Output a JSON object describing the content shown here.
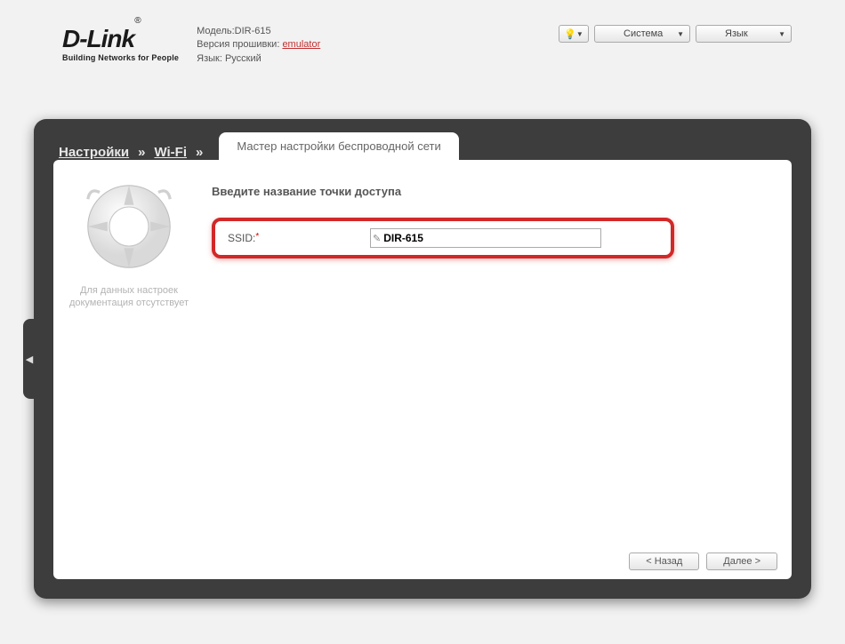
{
  "header": {
    "logo_main": "D-Link",
    "logo_sub": "Building Networks for People",
    "model_label": "Модель:",
    "model_value": "DIR-615",
    "fw_label": "Версия прошивки:",
    "fw_value": "emulator",
    "lang_label": "Язык:",
    "lang_value": "Русский",
    "btn_system": "Система",
    "btn_lang": "Язык"
  },
  "breadcrumb": {
    "item1": "Настройки",
    "item2": "Wi-Fi",
    "active": "Мастер настройки беспроводной сети"
  },
  "sidebar": {
    "help_text": "Для данных настроек документация отсутствует"
  },
  "main": {
    "title": "Введите название точки доступа",
    "ssid_label": "SSID:",
    "ssid_value": "DIR-615"
  },
  "footer": {
    "back": "< Назад",
    "next": "Далее >"
  }
}
